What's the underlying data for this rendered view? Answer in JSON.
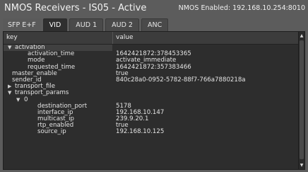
{
  "header": {
    "title": "NMOS Receivers - IS05 - Active",
    "status": "NMOS Enabled: 192.168.10.254:8010"
  },
  "tabs": [
    {
      "label": "SFP E+F"
    },
    {
      "label": "VID"
    },
    {
      "label": "AUD 1"
    },
    {
      "label": "AUD 2"
    },
    {
      "label": "ANC"
    }
  ],
  "table": {
    "col_key": "key",
    "col_value": "value",
    "rows": [
      {
        "key": "activation",
        "value": "",
        "arrow": "▼"
      },
      {
        "key": "activation_time",
        "value": "1642421872:378453365",
        "arrow": ""
      },
      {
        "key": "mode",
        "value": "activate_immediate",
        "arrow": ""
      },
      {
        "key": "requested_time",
        "value": "1642421872:357383466",
        "arrow": ""
      },
      {
        "key": "master_enable",
        "value": "true",
        "arrow": ""
      },
      {
        "key": "sender_id",
        "value": "840c28a0-0952-5782-88f7-766a7880218a",
        "arrow": ""
      },
      {
        "key": "transport_file",
        "value": "",
        "arrow": "▶"
      },
      {
        "key": "transport_params",
        "value": "",
        "arrow": "▼"
      },
      {
        "key": "0",
        "value": "",
        "arrow": "▼"
      },
      {
        "key": "destination_port",
        "value": "5178",
        "arrow": ""
      },
      {
        "key": "interface_ip",
        "value": "192.168.10.147",
        "arrow": ""
      },
      {
        "key": "multicast_ip",
        "value": "239.9.20.1",
        "arrow": ""
      },
      {
        "key": "rtp_enabled",
        "value": "true",
        "arrow": ""
      },
      {
        "key": "source_ip",
        "value": "192.168.10.125",
        "arrow": ""
      }
    ]
  },
  "icons": {
    "expanded": "▼",
    "collapsed": "▶",
    "scroll_up": "▲",
    "scroll_down": "▼"
  }
}
